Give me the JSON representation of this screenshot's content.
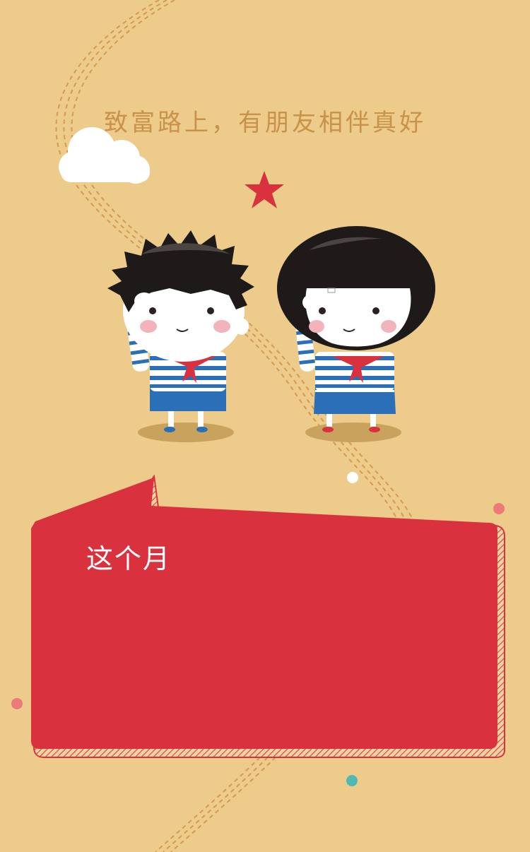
{
  "headline": "致富路上，有朋友相伴真好",
  "banner": {
    "title": "这个月"
  },
  "colors": {
    "background": "#edcb8a",
    "road_dash": "#d49a50",
    "banner_red": "#d9323e",
    "star_red": "#d9323e",
    "headline": "#c9924a",
    "dot_pink": "#ec7a78",
    "dot_teal": "#4fb9b4"
  },
  "icons": [
    "cloud-icon",
    "star-icon",
    "boy-illustration",
    "girl-illustration"
  ]
}
